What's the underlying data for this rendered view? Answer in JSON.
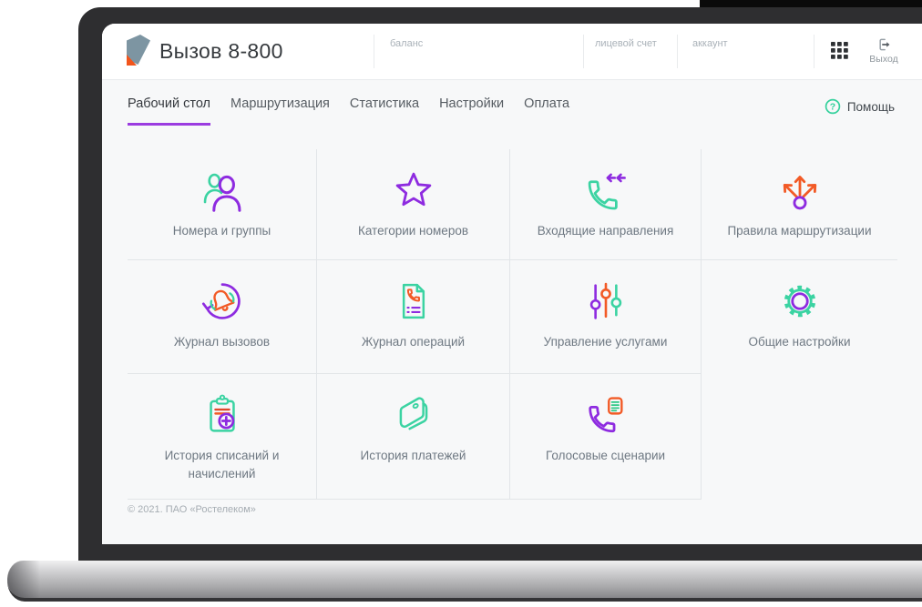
{
  "window": {
    "title": "Вызов 8-800"
  },
  "header": {
    "balance_label": "баланс",
    "personal_account_label": "лицевой счет",
    "account_label": "аккаунт",
    "logout_label": "Выход"
  },
  "nav": {
    "tabs": [
      {
        "label": "Рабочий стол",
        "active": true
      },
      {
        "label": "Маршрутизация",
        "active": false
      },
      {
        "label": "Статистика",
        "active": false
      },
      {
        "label": "Настройки",
        "active": false
      },
      {
        "label": "Оплата",
        "active": false
      }
    ],
    "help_label": "Помощь"
  },
  "tiles": [
    {
      "label": "Номера и группы",
      "icon": "people-icon"
    },
    {
      "label": "Категории номеров",
      "icon": "star-icon"
    },
    {
      "label": "Входящие направления",
      "icon": "incoming-call-icon"
    },
    {
      "label": "Правила маршрутизации",
      "icon": "routing-arrows-icon"
    },
    {
      "label": "Журнал вызовов",
      "icon": "call-log-icon"
    },
    {
      "label": "Журнал операций",
      "icon": "operations-log-icon"
    },
    {
      "label": "Управление услугами",
      "icon": "sliders-icon"
    },
    {
      "label": "Общие настройки",
      "icon": "gear-icon"
    },
    {
      "label": "История списаний и начислений",
      "icon": "billing-history-icon"
    },
    {
      "label": "История платежей",
      "icon": "payments-history-icon"
    },
    {
      "label": "Голосовые сценарии",
      "icon": "voice-scripts-icon"
    }
  ],
  "footer": {
    "copyright": "© 2021. ПАО «Ростелеком»"
  },
  "colors": {
    "accent_purple": "#8e2be0",
    "accent_teal": "#3bd3a2",
    "accent_orange": "#f25a26",
    "active_tab_underline": "#9b3ce0",
    "logo_slate": "#7d95a2",
    "logo_orange": "#f2551c"
  }
}
